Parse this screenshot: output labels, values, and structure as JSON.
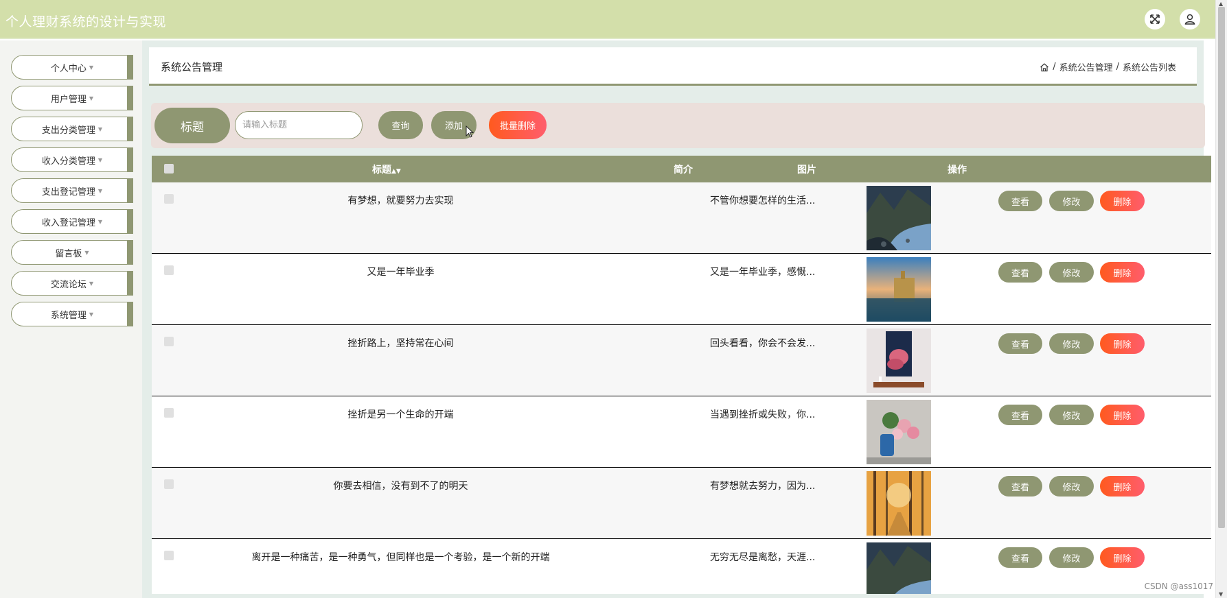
{
  "app": {
    "title": "个人理财系统的设计与实现"
  },
  "topbar": {
    "fullscreen_icon": "expand-arrows-icon",
    "user_icon": "user-icon"
  },
  "sidebar": {
    "items": [
      {
        "label": "个人中心"
      },
      {
        "label": "用户管理"
      },
      {
        "label": "支出分类管理"
      },
      {
        "label": "收入分类管理"
      },
      {
        "label": "支出登记管理"
      },
      {
        "label": "收入登记管理"
      },
      {
        "label": "留言板"
      },
      {
        "label": "交流论坛"
      },
      {
        "label": "系统管理"
      }
    ]
  },
  "header": {
    "title": "系统公告管理",
    "breadcrumb": [
      "系统公告管理",
      "系统公告列表"
    ],
    "separator": "/"
  },
  "search": {
    "label": "标题",
    "placeholder": "请输入标题",
    "query_label": "查询",
    "add_label": "添加",
    "batch_delete_label": "批量删除"
  },
  "table": {
    "columns": {
      "title": "标题",
      "intro": "简介",
      "image": "图片",
      "actions": "操作"
    },
    "rows": [
      {
        "title": "有梦想，就要努力去实现",
        "intro": "不管你想要怎样的生活...",
        "image": "mountain-river-photo"
      },
      {
        "title": "又是一年毕业季",
        "intro": "又是一年毕业季，感慨...",
        "image": "lake-castle-photo"
      },
      {
        "title": "挫折路上，坚持常在心间",
        "intro": "回头看看，你会不会发...",
        "image": "pink-cloud-painting-photo"
      },
      {
        "title": "挫折是另一个生命的开端",
        "intro": "当遇到挫折或失败，你...",
        "image": "pink-flowers-vase-photo"
      },
      {
        "title": "你要去相信，没有到不了的明天",
        "intro": "有梦想就去努力，因为...",
        "image": "autumn-forest-photo"
      },
      {
        "title": "离开是一种痛苦，是一种勇气，但同样也是一个考验，是一个新的开端",
        "intro": "无穷无尽是离愁，天涯...",
        "image": "mountain-river-photo"
      }
    ],
    "actions": {
      "view": "查看",
      "edit": "修改",
      "delete": "删除"
    }
  },
  "watermark": "CSDN @ass1017",
  "colors": {
    "topbar": "#d3dfaa",
    "primary": "#8f9772",
    "danger": "#ff5a5f",
    "search_bg": "#ebdfdb",
    "main_bg": "#e4ede9"
  }
}
